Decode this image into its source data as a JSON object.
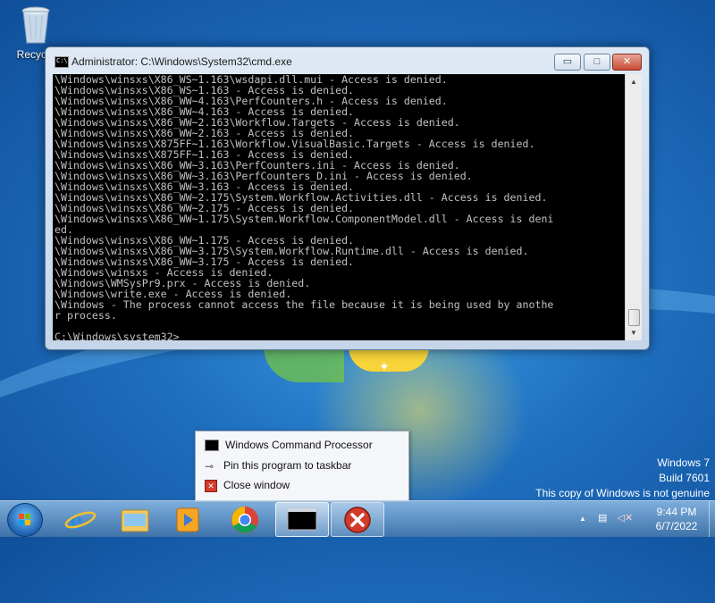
{
  "desktop": {
    "recycle_bin_label": "Recycle"
  },
  "cmd_window": {
    "title": "Administrator: C:\\Windows\\System32\\cmd.exe",
    "icon_text": "C:\\",
    "minimize_symbol": "▭",
    "maximize_symbol": "□",
    "close_symbol": "✕",
    "console_lines": [
      "\\Windows\\winsxs\\X86_WS~1.163\\wsdapi.dll.mui - Access is denied.",
      "\\Windows\\winsxs\\X86_WS~1.163 - Access is denied.",
      "\\Windows\\winsxs\\X86_WW~4.163\\PerfCounters.h - Access is denied.",
      "\\Windows\\winsxs\\X86_WW~4.163 - Access is denied.",
      "\\Windows\\winsxs\\X86_WW~2.163\\Workflow.Targets - Access is denied.",
      "\\Windows\\winsxs\\X86_WW~2.163 - Access is denied.",
      "\\Windows\\winsxs\\X875FF~1.163\\Workflow.VisualBasic.Targets - Access is denied.",
      "\\Windows\\winsxs\\X875FF~1.163 - Access is denied.",
      "\\Windows\\winsxs\\X86_WW~3.163\\PerfCounters.ini - Access is denied.",
      "\\Windows\\winsxs\\X86_WW~3.163\\PerfCounters_D.ini - Access is denied.",
      "\\Windows\\winsxs\\X86_WW~3.163 - Access is denied.",
      "\\Windows\\winsxs\\X86_WW~2.175\\System.Workflow.Activities.dll - Access is denied.",
      "\\Windows\\winsxs\\X86_WW~2.175 - Access is denied.",
      "\\Windows\\winsxs\\X86_WW~1.175\\System.Workflow.ComponentModel.dll - Access is deni",
      "ed.",
      "\\Windows\\winsxs\\X86_WW~1.175 - Access is denied.",
      "\\Windows\\winsxs\\X86_WW~3.175\\System.Workflow.Runtime.dll - Access is denied.",
      "\\Windows\\winsxs\\X86_WW~3.175 - Access is denied.",
      "\\Windows\\winsxs - Access is denied.",
      "\\Windows\\WMSysPr9.prx - Access is denied.",
      "\\Windows\\write.exe - Access is denied.",
      "\\Windows - The process cannot access the file because it is being used by anothe",
      "r process.",
      "",
      "C:\\Windows\\system32>"
    ]
  },
  "jump_list": {
    "items": [
      {
        "label": "Windows Command Processor"
      },
      {
        "label": "Pin this program to taskbar"
      },
      {
        "label": "Close window"
      }
    ]
  },
  "watermark": {
    "line1": "Windows 7",
    "line2": "Build 7601",
    "line3": "This copy of Windows is not genuine"
  },
  "taskbar": {
    "cmd_button_text": "C:\\_",
    "clock_time": "9:44 PM",
    "clock_date": "6/7/2022",
    "tray_arrow": "▲"
  },
  "colors": {
    "console_bg": "#000000",
    "console_text": "#c0c0c0",
    "error_red": "#d23b2a"
  },
  "icons": [
    "recycle-bin-icon",
    "cmd-icon",
    "pin-icon",
    "close-window-icon",
    "start-orb-icon",
    "internet-explorer-icon",
    "windows-explorer-icon",
    "media-player-icon",
    "chrome-icon",
    "error-icon",
    "network-icon",
    "volume-muted-icon"
  ]
}
